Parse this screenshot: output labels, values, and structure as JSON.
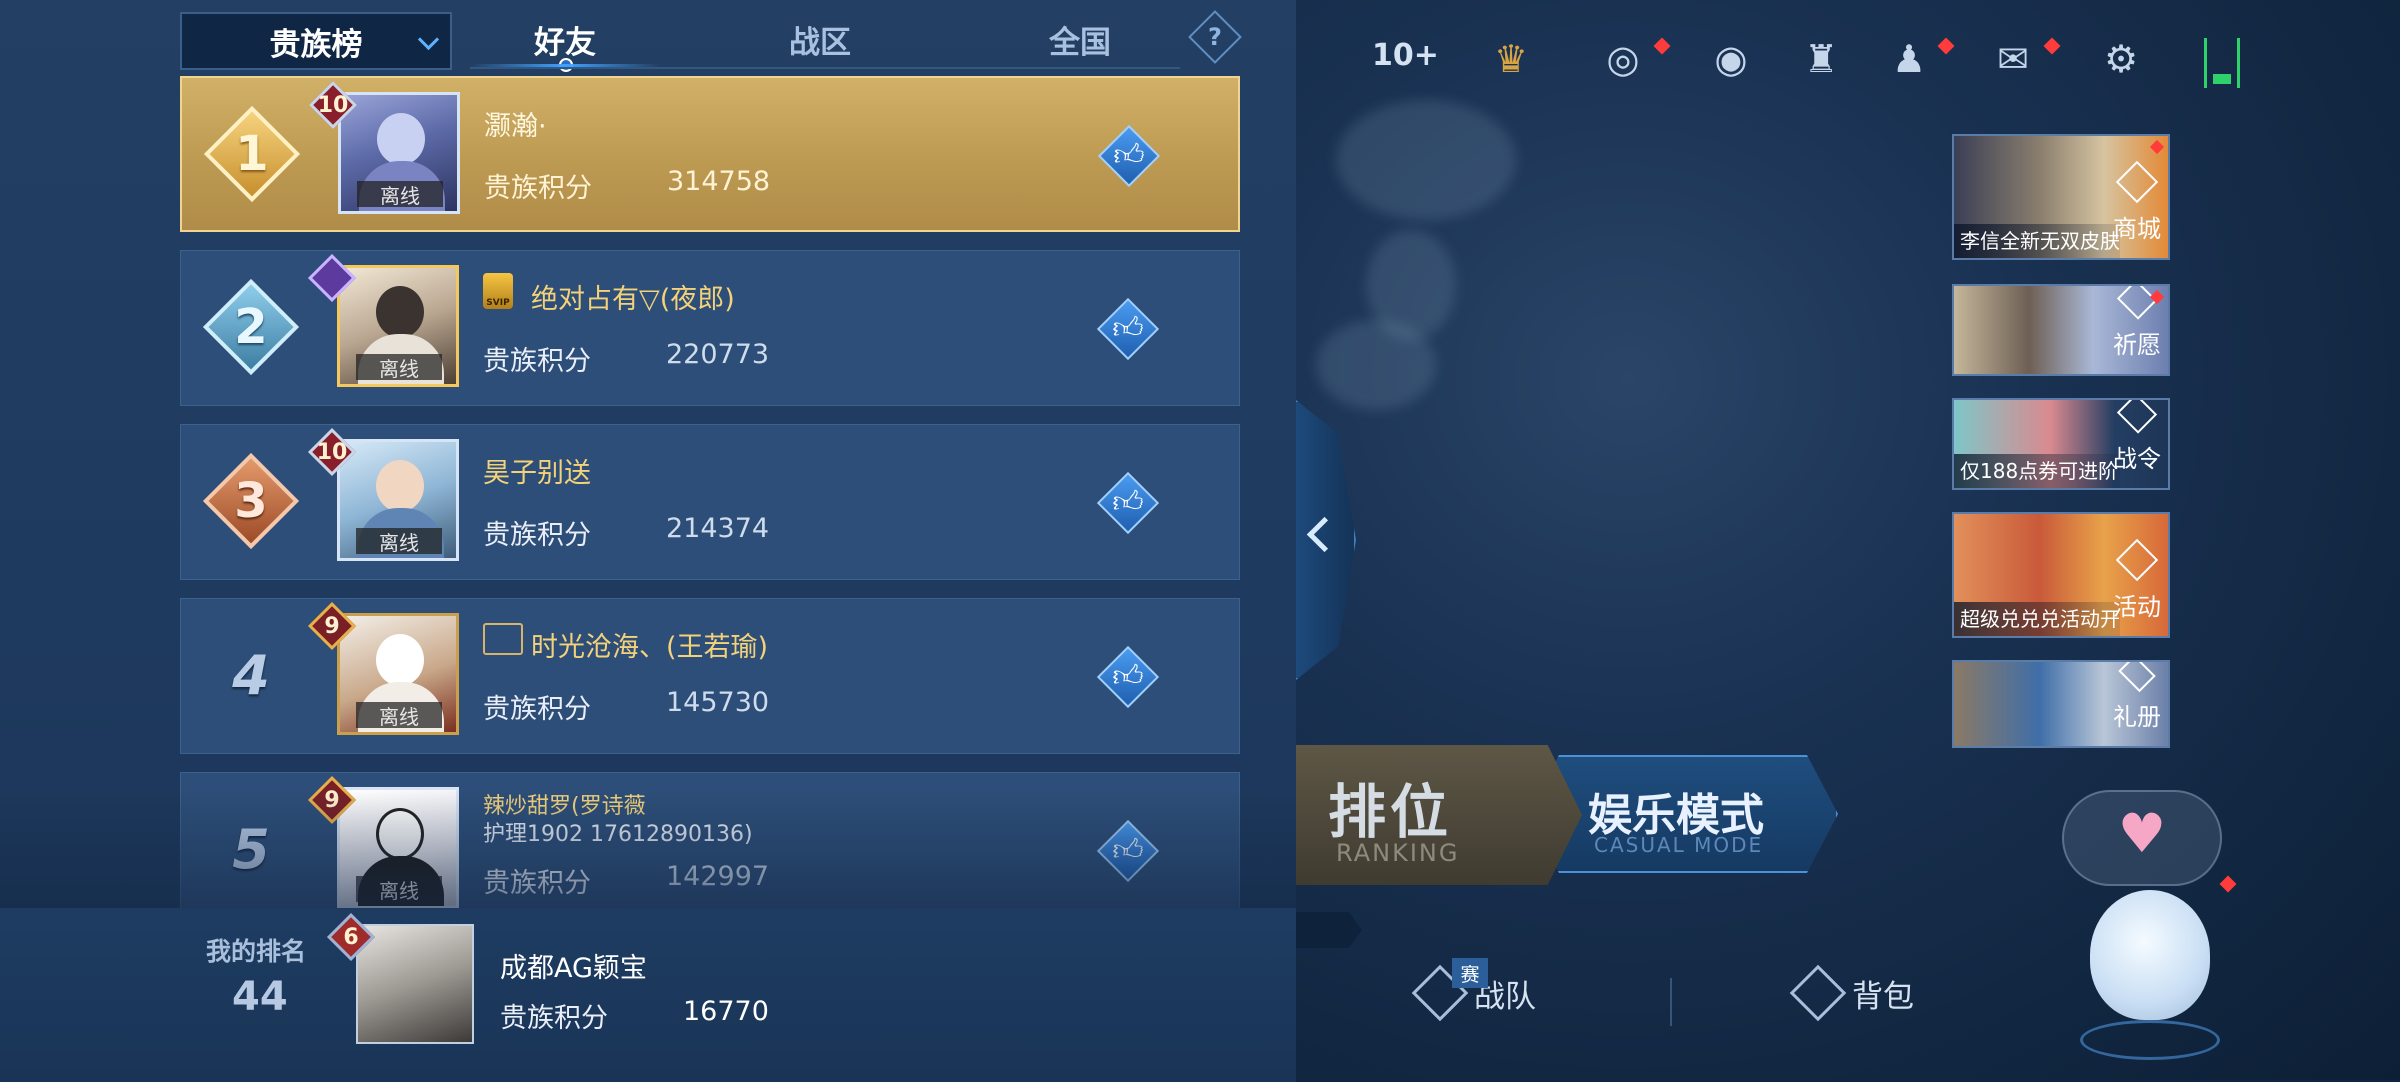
{
  "header": {
    "dropdown_label": "贵族榜",
    "tabs": [
      {
        "label": "好友",
        "active": true
      },
      {
        "label": "战区",
        "active": false
      },
      {
        "label": "全国",
        "active": false
      }
    ],
    "help_label": "?"
  },
  "score_label": "贵族积分",
  "offline_label": "离线",
  "rows": [
    {
      "rank": "1",
      "level": "10",
      "name": "灏瀚·",
      "score": "314758"
    },
    {
      "rank": "2",
      "level": "",
      "name": "绝对占有▽(夜郎)",
      "vip": "SVIP",
      "score": "220773"
    },
    {
      "rank": "3",
      "level": "10",
      "name": "昊子别送",
      "score": "214374"
    },
    {
      "rank": "4",
      "level": "9",
      "name": "时光沧海、(王若瑜)",
      "score": "145730"
    },
    {
      "rank": "5",
      "level": "9",
      "name_line1": "辣炒甜罗(罗诗薇",
      "name_line2": "护理1902  17612890136)",
      "score": "142997"
    }
  ],
  "my_rank": {
    "label": "我的排名",
    "rank": "44",
    "level": "6",
    "name": "成都AG颖宝",
    "score_label": "贵族积分",
    "score": "16770"
  },
  "topbar": {
    "friends_count": "10+"
  },
  "promos": [
    {
      "caption": "李信全新无双皮肤",
      "tag": "商城"
    },
    {
      "caption": "",
      "tag": "祈愿"
    },
    {
      "caption": "仅188点券可进阶",
      "tag": "战令"
    },
    {
      "caption": "超级兑兑兑活动开启",
      "tag": "活动"
    },
    {
      "caption": "",
      "tag": "礼册"
    }
  ],
  "modes": {
    "ranking_title": "排位",
    "ranking_sub": "RANKING",
    "casual_title": "娱乐模式",
    "casual_sub": "CASUAL MODE"
  },
  "bottom_nav": {
    "match_tag": "赛",
    "team_label": "战队",
    "bag_label": "背包"
  },
  "colors": {
    "gold_row": "#c9a65e",
    "row_bg": "#2d4e78",
    "accent_blue": "#3ea2ff",
    "name_gold": "#f3d27a"
  }
}
